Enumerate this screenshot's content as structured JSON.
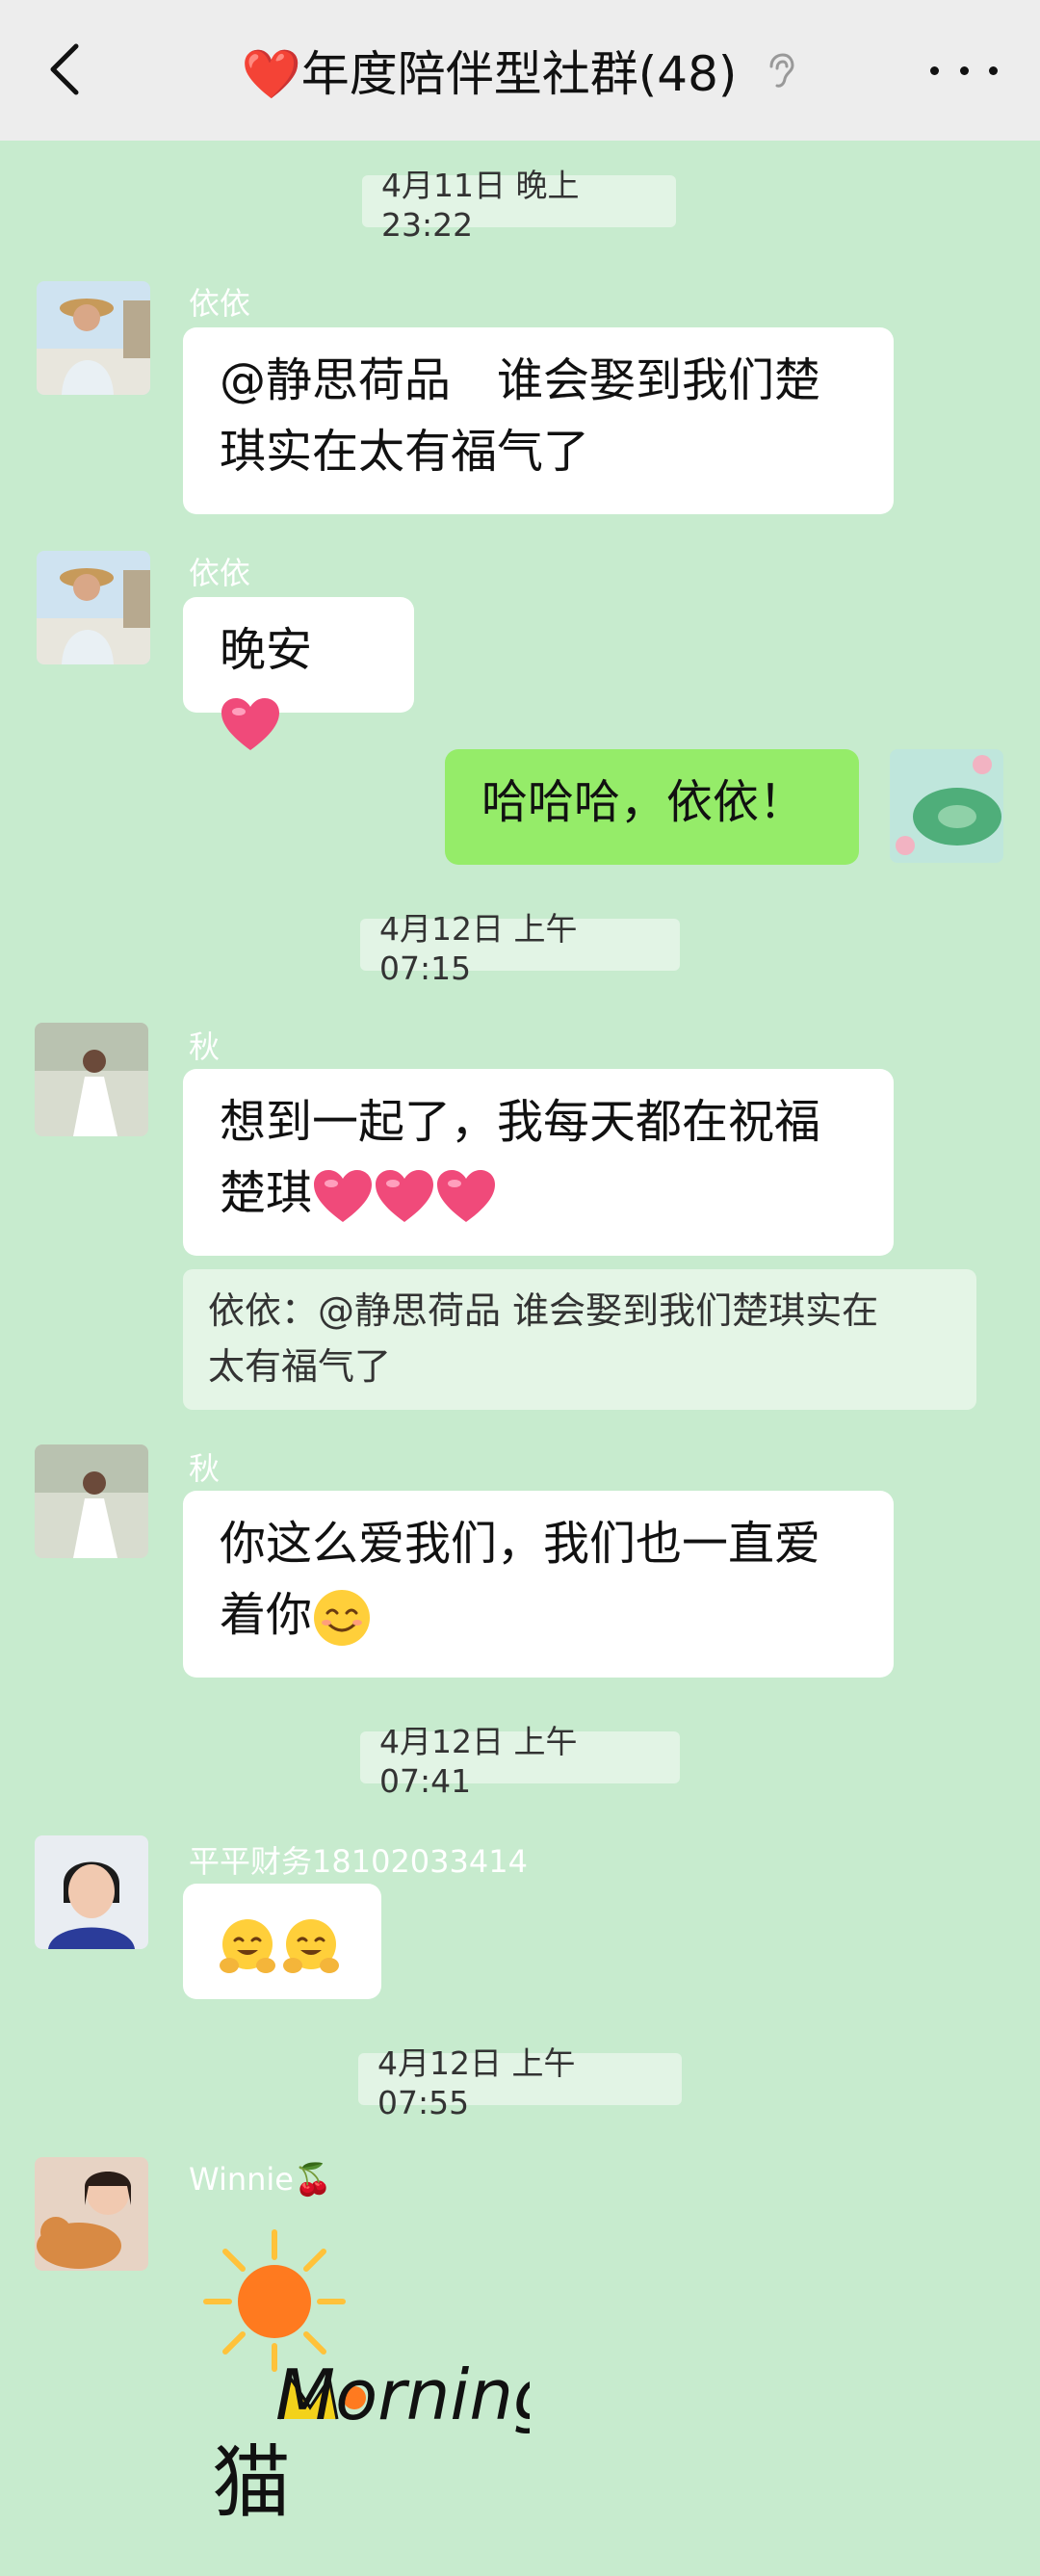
{
  "header": {
    "title": "❤️年度陪伴型社群(48)",
    "back_icon": "chevron-left-icon",
    "mode_icon": "ear-icon",
    "more_icon": "more-dots-icon"
  },
  "messages": {
    "ts1": "4月11日 晚上23:22",
    "m1_sender": "依依",
    "m1_text_a": "@静思荷品　谁会娶到我们楚",
    "m1_text_b": "琪实在太有福气了",
    "m2_sender": "依依",
    "m2_text": "晚安",
    "m3_text": "哈哈哈，依依！",
    "ts2": "4月12日 上午07:15",
    "m4_sender": "秋",
    "m4_text_a": "想到一起了，我每天都在祝福",
    "m4_text_b": "楚琪",
    "m4_quote_a": "依依：@静思荷品 谁会娶到我们楚琪实在",
    "m4_quote_b": "太有福气了",
    "m5_sender": "秋",
    "m5_text_a": "你这么爱我们，我们也一直爱",
    "m5_text_b": "着你",
    "ts3": "4月12日 上午07:41",
    "m6_sender": "平平财务18102033414",
    "ts4": "4月12日 上午07:55",
    "m7_sender": "Winnie🍒",
    "sticker_text": "Morning",
    "sticker_char": "猫"
  }
}
